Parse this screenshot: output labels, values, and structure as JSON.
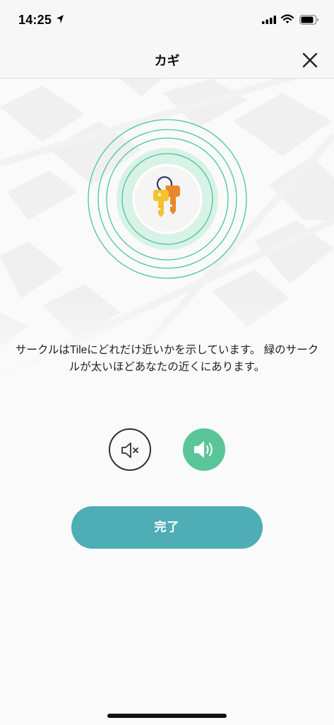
{
  "status_bar": {
    "time": "14:25",
    "icons": [
      "location-arrow-icon",
      "cellular-signal-icon",
      "wifi-icon",
      "battery-icon"
    ]
  },
  "nav": {
    "title": "カギ",
    "close_icon": "close-icon"
  },
  "tracker": {
    "item_icon": "keys-icon",
    "message": "サークルはTileにどれだけ近いかを示しています。 緑のサークルが太いほどあなたの近くにあります。"
  },
  "controls": {
    "mute_icon": "speaker-muted-icon",
    "sound_icon": "speaker-on-icon"
  },
  "done_button": {
    "label": "完了"
  },
  "colors": {
    "accent_green": "#5bc59a",
    "ring_green": "#49c59b",
    "done_teal": "#4fadb5",
    "mute_border": "#2c2f3a"
  }
}
